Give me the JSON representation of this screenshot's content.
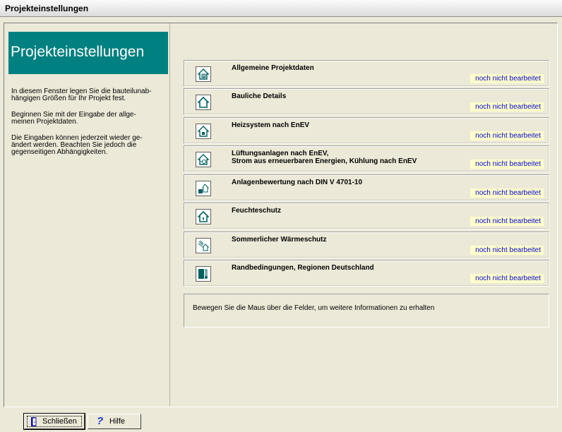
{
  "window": {
    "title": "Projekteinstellungen"
  },
  "sidebar": {
    "header": "Projekteinstellungen",
    "paragraphs": [
      "In diesem Fenster legen Sie die bauteilunab-\nhängigen Größen für Ihr Projekt fest.",
      "Beginnen Sie  mit der Eingabe der allge-\nmeinen Projektdaten.",
      "Die Eingaben können jederzeit wieder ge-\nändert werden. Beachten Sie jedoch die\ngegenseitigen Abhängigkeiten."
    ]
  },
  "sections": [
    {
      "title": "Allgemeine Projektdaten",
      "status": "noch nicht bearbeitet",
      "icon": "house-document-icon"
    },
    {
      "title": "Bauliche Details",
      "status": "noch nicht bearbeitet",
      "icon": "house-outline-icon"
    },
    {
      "title": "Heizsystem nach EnEV",
      "status": "noch nicht bearbeitet",
      "icon": "house-heating-icon"
    },
    {
      "title": "Lüftungsanlagen nach EnEV,\nStrom aus erneuerbaren Energien, Kühlung nach EnEV",
      "status": "noch nicht bearbeitet",
      "icon": "house-ventilation-icon"
    },
    {
      "title": "Anlagenbewertung nach DIN V 4701-10",
      "status": "noch nicht bearbeitet",
      "icon": "system-rating-icon"
    },
    {
      "title": "Feuchteschutz",
      "status": "noch nicht bearbeitet",
      "icon": "house-moisture-icon"
    },
    {
      "title": "Sommerlicher Wärmeschutz",
      "status": "noch nicht bearbeitet",
      "icon": "summer-heat-protection-icon"
    },
    {
      "title": "Randbedingungen, Regionen Deutschland",
      "status": "noch nicht bearbeitet",
      "icon": "thermometer-icon"
    }
  ],
  "info": {
    "text": "Bewegen Sie die Maus über die Felder, um weitere Informationen zu erhalten"
  },
  "buttons": {
    "close": "Schließen",
    "help": "Hilfe"
  },
  "colors": {
    "accent": "#008080",
    "status_bg": "#ffffcc",
    "status_text": "#0000cc"
  }
}
